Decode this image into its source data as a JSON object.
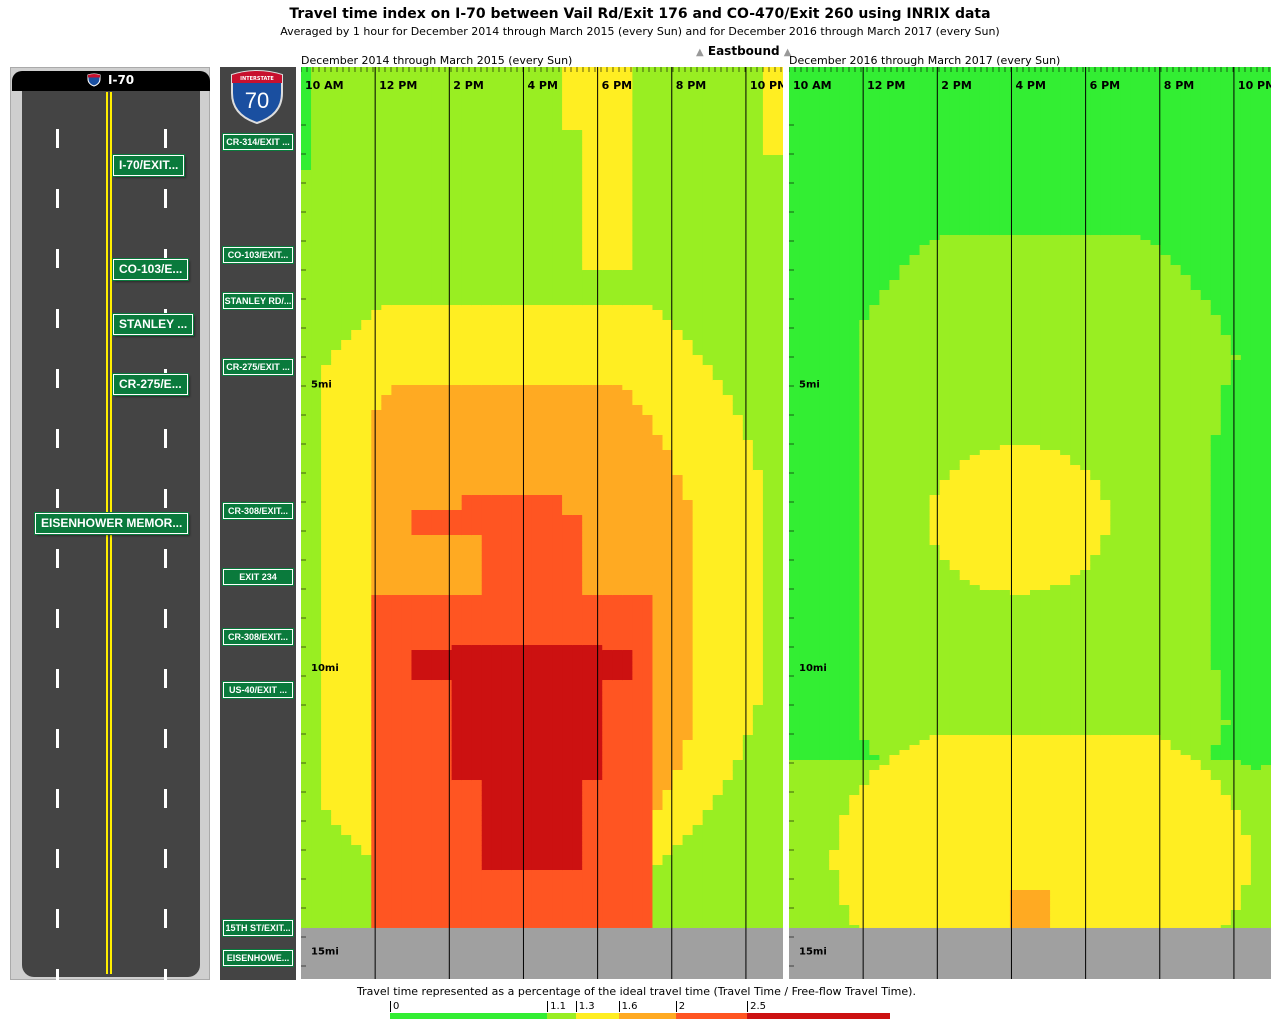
{
  "title": "Travel time index on I-70 between Vail Rd/Exit 176 and CO-470/Exit 260 using INRIX data",
  "subtitle": "Averaged by 1 hour for December 2014 through March 2015 (every Sun) and for December 2016 through March 2017 (every Sun)",
  "direction": "Eastbound",
  "road": {
    "name": "I-70",
    "shield_number": "70",
    "shield_text": "INTERSTATE"
  },
  "road_signs": [
    "I-70/EXIT...",
    "CO-103/E...",
    "STANLEY ...",
    "CR-275/E...",
    "EISENHOWER MEMOR..."
  ],
  "axis_signs": [
    "CR-314/EXIT ...",
    "CO-103/EXIT...",
    "STANLEY RD/...",
    "CR-275/EXIT ...",
    "CR-308/EXIT...",
    "EXIT 234",
    "CR-308/EXIT...",
    "US-40/EXIT ...",
    "15TH ST/EXIT...",
    "EISENHOWE..."
  ],
  "legend": {
    "caption": "Travel time represented as a percentage of the ideal travel time (Travel Time / Free-flow Travel Time).",
    "ticks": [
      "0",
      "1.1",
      "1.3",
      "1.6",
      "2",
      "2.5"
    ],
    "colors": [
      "#33ee33",
      "#99ee22",
      "#ffee22",
      "#ffaa22",
      "#ff5522",
      "#cc1111"
    ]
  },
  "chart_data": [
    {
      "type": "heatmap",
      "title": "December 2014 through March 2015 (every Sun)",
      "x_ticks": [
        "10 AM",
        "12 PM",
        "2 PM",
        "4 PM",
        "6 PM",
        "8 PM",
        "10 PM"
      ],
      "y_ticks": [
        "5mi",
        "10mi",
        "15mi"
      ],
      "x_hours": [
        10,
        23
      ],
      "y_miles": [
        0,
        15.5
      ],
      "no_data_from_mile": 14.6,
      "value_scale": [
        0,
        1.1,
        1.3,
        1.6,
        2.0,
        2.5
      ],
      "features": [
        {
          "type": "rect",
          "x": [
            10,
            23
          ],
          "y": [
            0,
            14.6
          ],
          "v": 1.2
        },
        {
          "type": "rect",
          "x": [
            10,
            10.4
          ],
          "y": [
            0,
            1.2
          ],
          "v": 1.0
        },
        {
          "type": "rect",
          "x": [
            17.7,
            19.0
          ],
          "y": [
            0,
            3.0
          ],
          "v": 1.4
        },
        {
          "type": "rect",
          "x": [
            17.0,
            17.7
          ],
          "y": [
            0,
            0.5
          ],
          "v": 1.4
        },
        {
          "type": "rect",
          "x": [
            22.5,
            23.0
          ],
          "y": [
            0,
            1.0
          ],
          "v": 1.4
        },
        {
          "type": "ellipse",
          "cx": 15.8,
          "cy": 8.6,
          "rx": 7.0,
          "ry": 5.8,
          "v": 1.45,
          "clip": [
            10.6,
            22.4,
            3.6,
            14.6
          ]
        },
        {
          "type": "ellipse",
          "cx": 15.6,
          "cy": 9.2,
          "rx": 5.3,
          "ry": 5.1,
          "v": 1.8,
          "clip": [
            12.0,
            20.6,
            5.0,
            14.6
          ]
        },
        {
          "type": "rect",
          "x": [
            12.0,
            19.6
          ],
          "y": [
            8.7,
            14.6
          ],
          "v": 2.2
        },
        {
          "type": "rect",
          "x": [
            15.0,
            17.6
          ],
          "y": [
            7.3,
            9.2
          ],
          "v": 2.2
        },
        {
          "type": "rect",
          "x": [
            13.0,
            16.6
          ],
          "y": [
            7.2,
            7.7
          ],
          "v": 2.2
        },
        {
          "type": "rect",
          "x": [
            14.4,
            17.1
          ],
          "y": [
            7.0,
            7.4
          ],
          "v": 2.2
        },
        {
          "type": "rect",
          "x": [
            13.0,
            19.0
          ],
          "y": [
            9.7,
            10.2
          ],
          "v": 2.7
        },
        {
          "type": "rect",
          "x": [
            14.0,
            18.0
          ],
          "y": [
            9.6,
            12.0
          ],
          "v": 2.7
        },
        {
          "type": "rect",
          "x": [
            15.0,
            17.6
          ],
          "y": [
            12.0,
            13.6
          ],
          "v": 2.7
        }
      ]
    },
    {
      "type": "heatmap",
      "title": "December 2016 through March 2017 (every Sun)",
      "x_ticks": [
        "10 AM",
        "12 PM",
        "2 PM",
        "4 PM",
        "6 PM",
        "8 PM",
        "10 PM"
      ],
      "y_ticks": [
        "5mi",
        "10mi",
        "15mi"
      ],
      "x_hours": [
        10,
        23
      ],
      "y_miles": [
        0,
        15.5
      ],
      "no_data_from_mile": 14.6,
      "value_scale": [
        0,
        1.1,
        1.3,
        1.6,
        2.0,
        2.5
      ],
      "features": [
        {
          "type": "rect",
          "x": [
            10,
            23
          ],
          "y": [
            0,
            14.6
          ],
          "v": 1.0
        },
        {
          "type": "ellipse",
          "cx": 16.8,
          "cy": 7.6,
          "rx": 6.2,
          "ry": 5.8,
          "v": 1.2,
          "clip": [
            12.0,
            23.0,
            2.4,
            14.6
          ]
        },
        {
          "type": "rect",
          "x": [
            10.0,
            23.0
          ],
          "y": [
            11.6,
            14.6
          ],
          "v": 1.2
        },
        {
          "type": "ellipse",
          "cx": 16.8,
          "cy": 13.4,
          "rx": 5.6,
          "ry": 2.6,
          "v": 1.4,
          "clip": [
            10.0,
            23.0,
            11.2,
            14.6
          ]
        },
        {
          "type": "ellipse",
          "cx": 16.2,
          "cy": 7.4,
          "rx": 2.4,
          "ry": 1.3,
          "v": 1.4,
          "clip": [
            10.0,
            23.0,
            0,
            14.6
          ]
        },
        {
          "type": "rect",
          "x": [
            16.0,
            17.0
          ],
          "y": [
            13.9,
            14.6
          ],
          "v": 1.7
        },
        {
          "type": "ellipse",
          "cx": 22.6,
          "cy": 8.0,
          "rx": 1.3,
          "ry": 3.8,
          "v": 1.0,
          "clip": [
            10.0,
            23.0,
            0,
            14.6
          ]
        }
      ]
    }
  ]
}
